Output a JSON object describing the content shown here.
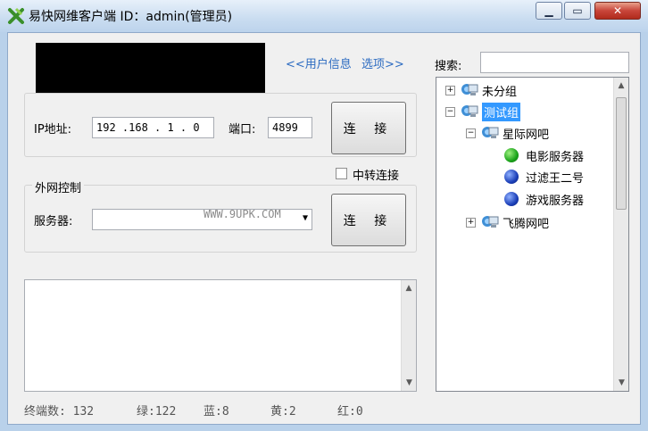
{
  "window": {
    "title": "易快网维客户端 ID：admin(管理员)",
    "minimize_glyph": "▁",
    "maximize_glyph": "▭",
    "close_glyph": "✕"
  },
  "header": {
    "user_info_link": "<<用户信息",
    "options_link": "选项>>"
  },
  "lan": {
    "ip_label": "IP地址:",
    "ip_value": "192 .168 . 1  . 0",
    "port_label": "端口:",
    "port_value": "4899",
    "connect_label": "连 接"
  },
  "relay": {
    "label": "中转连接",
    "checked": false
  },
  "wan": {
    "group_title": "外网控制",
    "server_label": "服务器:",
    "server_value": "",
    "watermark": "WWW.9UPK.COM",
    "connect_label": "连 接"
  },
  "search": {
    "label": "搜索:",
    "value": ""
  },
  "tree": {
    "nodes": [
      {
        "label": "未分组",
        "expander": "+"
      },
      {
        "label": "测试组",
        "expander": "−",
        "selected": true
      },
      {
        "label": "星际网吧",
        "expander": "−"
      },
      {
        "label": "电影服务器",
        "status": "#1aa31a"
      },
      {
        "label": "过滤王二号",
        "status": "#1b3fb8"
      },
      {
        "label": "游戏服务器",
        "status": "#1b3fb8"
      },
      {
        "label": "飞腾网吧",
        "expander": "+"
      }
    ]
  },
  "status": {
    "terminals": "终端数: 132",
    "green": "绿:122",
    "blue": "蓝:8",
    "yellow": "黄:2",
    "red": "红:0"
  },
  "colors": {
    "selected_bg": "#3399ff",
    "redaction": "#000000"
  }
}
